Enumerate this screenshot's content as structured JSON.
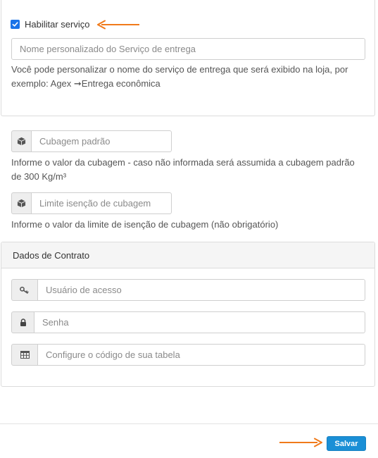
{
  "service": {
    "enable_label": "Habilitar serviço",
    "enabled": true,
    "custom_name_placeholder": "Nome personalizado do Serviço de entrega",
    "custom_name_help": "Você pode personalizar o nome do serviço de entrega que será exibido na loja, por exemplo: Agex ➞Entrega econômica"
  },
  "cubage": {
    "default_placeholder": "Cubagem padrão",
    "default_icon": "box-icon",
    "default_help": "Informe o valor da cubagem - caso não informada será assumida a cubagem padrão de 300 Kg/m³",
    "exemption_placeholder": "Limite isenção de cubagem",
    "exemption_icon": "box-icon",
    "exemption_help": "Informe o valor da limite de isenção de cubagem (não obrigatório)"
  },
  "contract": {
    "heading": "Dados de Contrato",
    "username_placeholder": "Usuário de acesso",
    "username_icon": "key-icon",
    "password_placeholder": "Senha",
    "password_icon": "lock-icon",
    "table_code_placeholder": "Configure o código de sua tabela",
    "table_code_icon": "table-icon"
  },
  "footer": {
    "save_label": "Salvar"
  },
  "colors": {
    "accent": "#1a8fd6",
    "checkbox": "#1a73e8",
    "arrow": "#f07a1a"
  }
}
